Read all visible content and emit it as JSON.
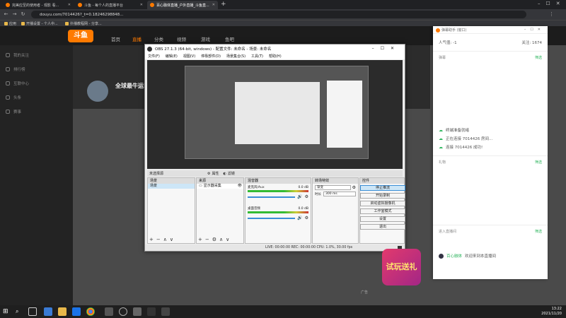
{
  "browser": {
    "tabs": [
      {
        "title": "完美应至的使用者 - 观影 看..."
      },
      {
        "title": "斗鱼 - 每个人的直播平台"
      },
      {
        "title": "百心融体直播_户外直播_斗鱼直..."
      }
    ],
    "url": "douyu.com/7014426?_t=0.18246298848...",
    "bookmarks": [
      {
        "label": "应用"
      },
      {
        "label": "开播设置 - 个人中..."
      },
      {
        "label": "扑播教程网 - 分享..."
      }
    ]
  },
  "site": {
    "logo_text": "斗鱼",
    "nav": [
      "首页",
      "直播",
      "分类",
      "视频",
      "游戏",
      "鱼吧"
    ],
    "left_menu": [
      "我的关注",
      "排行榜",
      "互联中心",
      "头条",
      "赛事"
    ],
    "stream_title": "全球最牛运动员",
    "ad_label": "广告"
  },
  "obs": {
    "title": "OBS 27.1.3 (64-bit, windows) - 配置文件: 未命名 - 场景: 未命名",
    "menu": [
      "文件(F)",
      "编辑(E)",
      "视图(V)",
      "停靠部件(D)",
      "场景集合(S)",
      "工具(T)",
      "帮助(H)"
    ],
    "preview_bar": {
      "no_source": "未选择源",
      "properties": "属性",
      "filters": "滤镜"
    },
    "docks": {
      "scenes": {
        "title": "场景",
        "items": [
          "场景"
        ]
      },
      "sources": {
        "title": "来源",
        "items": [
          "显示器采集"
        ]
      },
      "mixer": {
        "title": "混音器",
        "channels": [
          {
            "name": "麦克风/Aux",
            "level": "0.0 dB"
          },
          {
            "name": "桌面音频",
            "level": "0.0 dB"
          }
        ]
      },
      "transitions": {
        "title": "转场特效",
        "type": "渐变",
        "duration_label": "时长",
        "duration": "300 ms"
      },
      "controls": {
        "title": "控件",
        "buttons": [
          "停止推流",
          "开始录制",
          "启动虚拟摄像机",
          "工作室模式",
          "设置",
          "退出"
        ]
      }
    },
    "status": "LIVE: 00:00:00   REC: 00:00:00   CPU: 1.0%, 30.00 fps"
  },
  "chat": {
    "title": "弹幕助手 (窗口)",
    "popularity_label": "人气值:",
    "popularity": "-1",
    "follows_label": "关注:",
    "follows": "1674",
    "section_danmu": "弹幕",
    "section_gift": "礼物",
    "section_enter": "进入直播间",
    "settings": "筛选",
    "events": [
      "终端准备就绪",
      "正在连接 7014426 房间...",
      "连接 7014426 成功!"
    ],
    "welcome": "欢迎来到本直播间",
    "welcome_user": "百心融体"
  },
  "gift_banner": "试玩送礼",
  "taskbar": {
    "time": "13:22",
    "date": "2021/11/20"
  },
  "colors": {
    "accent": "#ff7a00",
    "obs_active": "#3a8ed6",
    "chat_green": "#2db55d"
  }
}
